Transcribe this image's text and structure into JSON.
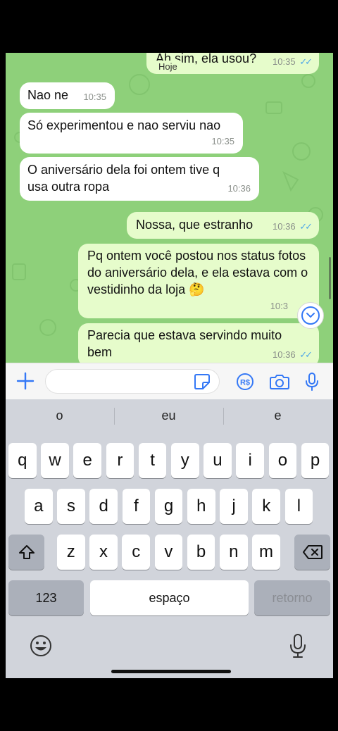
{
  "chat": {
    "date_chip": "Hoje",
    "messages": [
      {
        "dir": "out",
        "text": "Ah sim, ela usou?",
        "time": "10:35",
        "read": true
      },
      {
        "dir": "in",
        "text": "Nao ne",
        "time": "10:35"
      },
      {
        "dir": "in",
        "text": "Só experimentou e nao serviu nao",
        "time": "10:35"
      },
      {
        "dir": "in",
        "text": "O aniversário dela foi ontem tive q usa outra ropa",
        "time": "10:36"
      },
      {
        "dir": "out",
        "text": "Nossa, que estranho",
        "time": "10:36",
        "read": true
      },
      {
        "dir": "out",
        "text": "Pq ontem você postou nos status fotos do aniversário dela, e ela estava com o vestidinho da loja 🤔",
        "time": "10:3",
        "read": false
      },
      {
        "dir": "out",
        "text": "Parecia que estava servindo muito bem",
        "time": "10:36",
        "read": true
      }
    ],
    "ticks": "✓✓",
    "scroll_down_icon": "chevron-down-circle-icon"
  },
  "input_bar": {
    "plus_icon": "plus-icon",
    "input_value": "",
    "input_placeholder": "",
    "sticker_icon": "sticker-icon",
    "pix_icon": "pix-payment-icon",
    "pix_label": "R$",
    "camera_icon": "camera-icon",
    "mic_icon": "microphone-icon"
  },
  "keyboard": {
    "suggestions": [
      "o",
      "eu",
      "e"
    ],
    "row1": [
      "q",
      "w",
      "e",
      "r",
      "t",
      "y",
      "u",
      "i",
      "o",
      "p"
    ],
    "row2": [
      "a",
      "s",
      "d",
      "f",
      "g",
      "h",
      "j",
      "k",
      "l"
    ],
    "row3": [
      "z",
      "x",
      "c",
      "v",
      "b",
      "n",
      "m"
    ],
    "numbers_key": "123",
    "space_key": "espaço",
    "return_key": "retorno",
    "shift_icon": "shift-icon",
    "delete_icon": "backspace-icon",
    "emoji_icon": "emoji-icon",
    "dictation_icon": "microphone-icon"
  },
  "colors": {
    "chat_bg": "#8ed07a",
    "incoming_bubble": "#ffffff",
    "outgoing_bubble": "#e6fccb",
    "accent": "#3478f6",
    "read_ticks": "#4fa8e8"
  }
}
